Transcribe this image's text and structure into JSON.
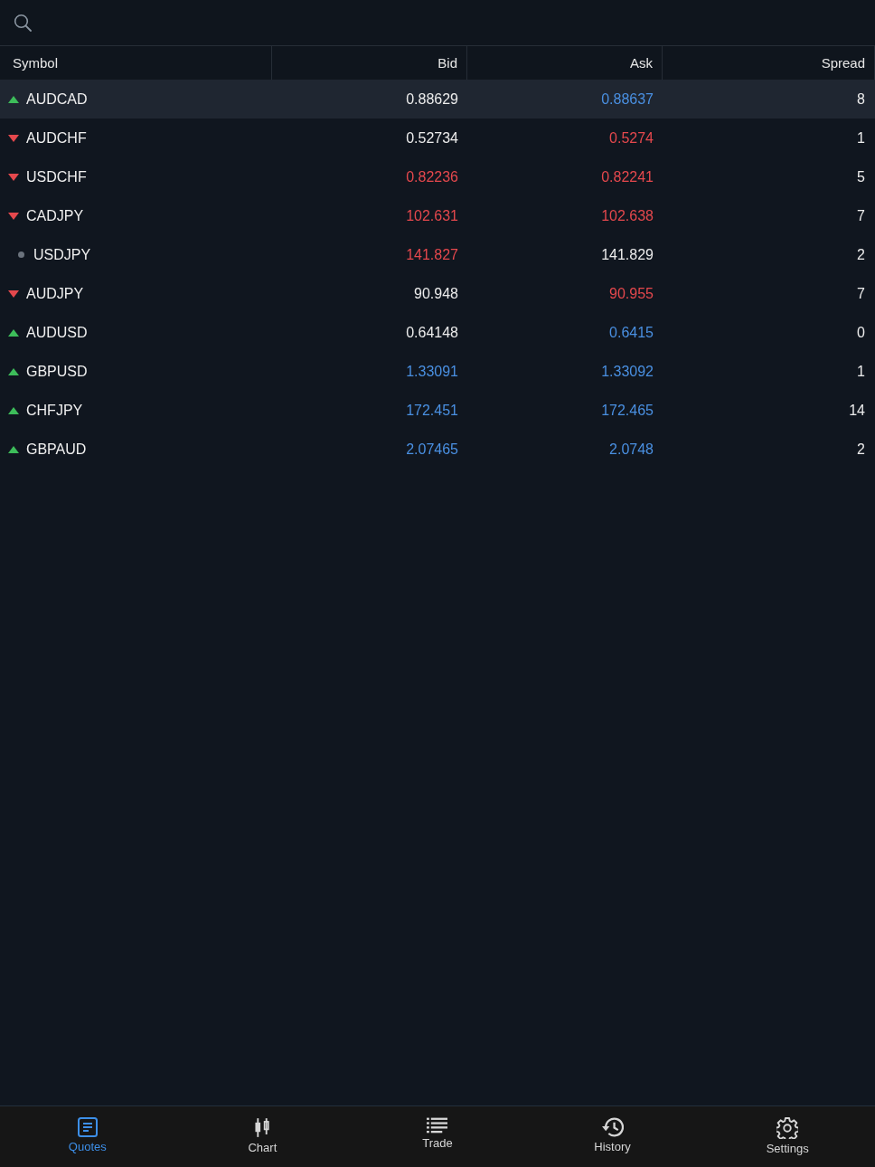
{
  "table": {
    "columns": [
      "Symbol",
      "Bid",
      "Ask",
      "Spread"
    ],
    "rows": [
      {
        "kind": "up",
        "symbol": "AUDCAD",
        "bid": {
          "text": "0.88629",
          "color": "#ececec"
        },
        "ask": {
          "text": "0.88637",
          "color": "#4a90e2"
        },
        "spread": "8",
        "selected": true
      },
      {
        "kind": "down",
        "symbol": "AUDCHF",
        "bid": {
          "text": "0.52734",
          "color": "#ececec"
        },
        "ask": {
          "text": "0.5274",
          "color": "#e5484d"
        },
        "spread": "1",
        "selected": false
      },
      {
        "kind": "down",
        "symbol": "USDCHF",
        "bid": {
          "text": "0.82236",
          "color": "#e5484d"
        },
        "ask": {
          "text": "0.82241",
          "color": "#e5484d"
        },
        "spread": "5",
        "selected": false
      },
      {
        "kind": "down",
        "symbol": "CADJPY",
        "bid": {
          "text": "102.631",
          "color": "#e5484d"
        },
        "ask": {
          "text": "102.638",
          "color": "#e5484d"
        },
        "spread": "7",
        "selected": false
      },
      {
        "kind": "flat",
        "symbol": "USDJPY",
        "bid": {
          "text": "141.827",
          "color": "#e5484d"
        },
        "ask": {
          "text": "141.829",
          "color": "#ececec"
        },
        "spread": "2",
        "selected": false
      },
      {
        "kind": "down",
        "symbol": "AUDJPY",
        "bid": {
          "text": "90.948",
          "color": "#ececec"
        },
        "ask": {
          "text": "90.955",
          "color": "#e5484d"
        },
        "spread": "7",
        "selected": false
      },
      {
        "kind": "up",
        "symbol": "AUDUSD",
        "bid": {
          "text": "0.64148",
          "color": "#ececec"
        },
        "ask": {
          "text": "0.6415",
          "color": "#4a90e2"
        },
        "spread": "0",
        "selected": false
      },
      {
        "kind": "up",
        "symbol": "GBPUSD",
        "bid": {
          "text": "1.33091",
          "color": "#4a90e2"
        },
        "ask": {
          "text": "1.33092",
          "color": "#4a90e2"
        },
        "spread": "1",
        "selected": false
      },
      {
        "kind": "up",
        "symbol": "CHFJPY",
        "bid": {
          "text": "172.451",
          "color": "#4a90e2"
        },
        "ask": {
          "text": "172.465",
          "color": "#4a90e2"
        },
        "spread": "14",
        "selected": false
      },
      {
        "kind": "up",
        "symbol": "GBPAUD",
        "bid": {
          "text": "2.07465",
          "color": "#4a90e2"
        },
        "ask": {
          "text": "2.0748",
          "color": "#4a90e2"
        },
        "spread": "2",
        "selected": false
      }
    ]
  },
  "tabs": [
    {
      "label": "Quotes",
      "selected": true
    },
    {
      "label": "Chart",
      "selected": false
    },
    {
      "label": "Trade",
      "selected": false
    },
    {
      "label": "History",
      "selected": false
    },
    {
      "label": "Settings",
      "selected": false
    }
  ]
}
